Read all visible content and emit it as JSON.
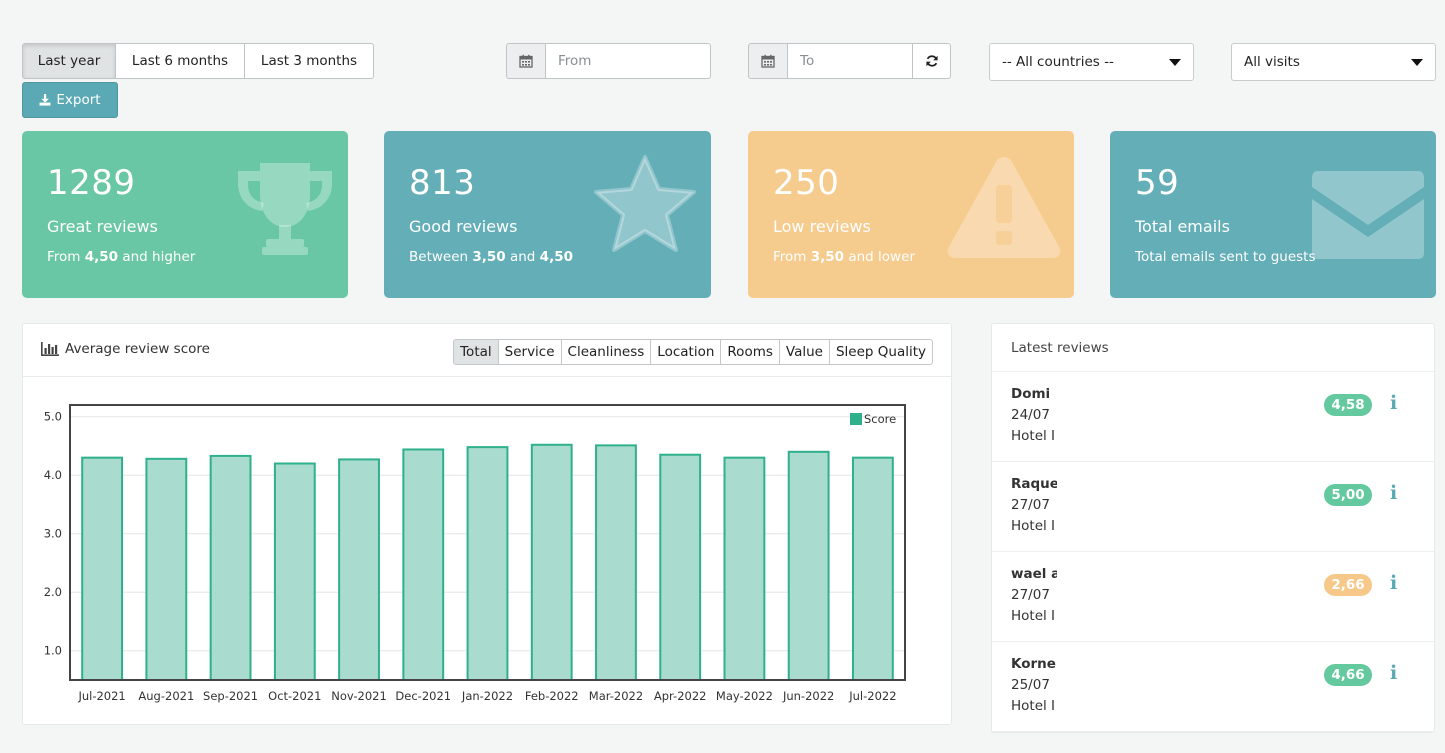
{
  "filters": {
    "range_buttons": [
      "Last year",
      "Last 6 months",
      "Last 3 months"
    ],
    "active_range": "Last year",
    "from_placeholder": "From",
    "to_placeholder": "To",
    "country_select": "-- All countries --",
    "visits_select": "All visits",
    "export_label": "Export"
  },
  "colors": {
    "green": "#6ac7a5",
    "teal": "#64aeb8",
    "orange": "#f6cb8e",
    "bar_fill": "#a9dccf",
    "bar_stroke": "#2fb08c",
    "badge_green": "#64c99e",
    "badge_orange": "#f6c98a"
  },
  "cards": [
    {
      "number": "1289",
      "title": "Great reviews",
      "sub_pre": "From ",
      "sub_b1": "4,50",
      "sub_mid": " and higher",
      "sub_b2": "",
      "icon": "trophy-icon"
    },
    {
      "number": "813",
      "title": "Good reviews",
      "sub_pre": "Between ",
      "sub_b1": "3,50",
      "sub_mid": " and ",
      "sub_b2": "4,50",
      "icon": "star-icon"
    },
    {
      "number": "250",
      "title": "Low reviews",
      "sub_pre": "From ",
      "sub_b1": "3,50",
      "sub_mid": " and lower",
      "sub_b2": "",
      "icon": "warning-icon"
    },
    {
      "number": "59",
      "title": "Total emails",
      "sub_pre": "Total emails sent to guests",
      "sub_b1": "",
      "sub_mid": "",
      "sub_b2": "",
      "icon": "envelope-icon"
    }
  ],
  "chart_panel": {
    "title": "Average review score",
    "tabs": [
      "Total",
      "Service",
      "Cleanliness",
      "Location",
      "Rooms",
      "Value",
      "Sleep Quality"
    ],
    "active_tab": "Total"
  },
  "chart_data": {
    "type": "bar",
    "categories": [
      "Jul-2021",
      "Aug-2021",
      "Sep-2021",
      "Oct-2021",
      "Nov-2021",
      "Dec-2021",
      "Jan-2022",
      "Feb-2022",
      "Mar-2022",
      "Apr-2022",
      "May-2022",
      "Jun-2022",
      "Jul-2022"
    ],
    "series": [
      {
        "name": "Score",
        "values": [
          4.3,
          4.28,
          4.33,
          4.2,
          4.27,
          4.44,
          4.48,
          4.52,
          4.51,
          4.35,
          4.3,
          4.4,
          4.3
        ]
      }
    ],
    "yticks": [
      "5.0",
      "4.0",
      "3.0",
      "2.0",
      "1.0"
    ],
    "ylim": [
      0.5,
      5.2
    ],
    "legend": "top-right",
    "grid": true
  },
  "reviews": {
    "title": "Latest reviews",
    "items": [
      {
        "name": "Domi",
        "date": "24/07",
        "hotel": "Hotel I",
        "score": "4,58",
        "level": "good"
      },
      {
        "name": "Raque",
        "date": "27/07",
        "hotel": "Hotel I",
        "score": "5,00",
        "level": "good"
      },
      {
        "name": "wael a",
        "date": "27/07",
        "hotel": "Hotel I",
        "score": "2,66",
        "level": "low"
      },
      {
        "name": "Korne",
        "date": "25/07",
        "hotel": "Hotel I",
        "score": "4,66",
        "level": "good"
      }
    ]
  }
}
